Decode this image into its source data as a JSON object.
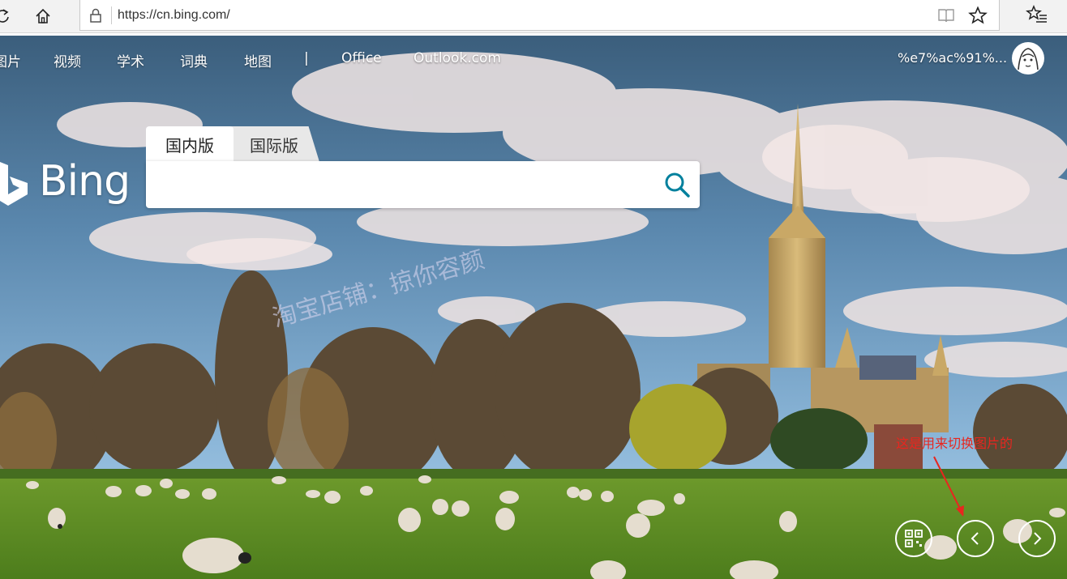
{
  "browser": {
    "url": "https://cn.bing.com/"
  },
  "nav": {
    "items": [
      "图片",
      "视频",
      "学术",
      "词典",
      "地图",
      "|",
      "Office",
      "Outlook.com"
    ],
    "user_name": "%e7%ac%91%..."
  },
  "logo": {
    "text": "Bing"
  },
  "search": {
    "tabs": [
      "国内版",
      "国际版"
    ],
    "placeholder": ""
  },
  "watermark": "淘宝店铺：掠你容颜",
  "annotation": "这是用来切换图片的",
  "icons": {
    "refresh": "refresh-icon",
    "home": "home-icon",
    "lock": "lock-icon",
    "reading_view": "reading-view-icon",
    "favorite": "star-icon",
    "hub": "hub-icon",
    "search": "search-icon",
    "qr": "qr-code-icon",
    "prev": "chevron-left-icon",
    "next": "chevron-right-icon"
  },
  "colors": {
    "search_icon": "#00809d",
    "annotation": "#e8261f"
  }
}
